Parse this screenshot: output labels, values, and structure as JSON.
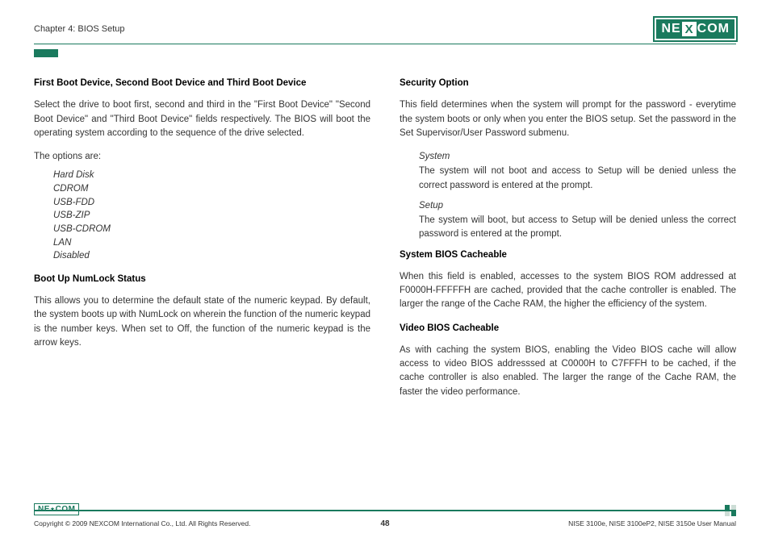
{
  "brand": {
    "ne": "NE",
    "x": "X",
    "com": "COM",
    "small": "NE⋆COM"
  },
  "header": {
    "chapter": "Chapter 4: BIOS Setup"
  },
  "left": {
    "h1": "First Boot Device, Second Boot Device and Third Boot Device",
    "p1": "Select the drive to boot first, second and third in the \"First Boot Device\" \"Second Boot Device\" and \"Third Boot Device\" fields respectively. The BIOS will boot the operating system according to the sequence of the drive selected.",
    "p2": "The options are:",
    "options": [
      "Hard Disk",
      "CDROM",
      "USB-FDD",
      "USB-ZIP",
      "USB-CDROM",
      "LAN",
      "Disabled"
    ],
    "h2": "Boot Up NumLock Status",
    "p3": "This allows you to determine the default state of the numeric keypad. By default, the system boots up with NumLock on wherein the function of the numeric keypad is the number keys. When set to Off, the function of the numeric keypad is the arrow keys."
  },
  "right": {
    "h1": "Security Option",
    "p1": "This field determines when the system will prompt for the password - everytime the system boots or only when you enter the BIOS setup. Set the password in the Set Supervisor/User Password submenu.",
    "sub1_title": "System",
    "sub1_text": "The system will not boot and access to Setup will be denied unless the correct password is entered at the prompt.",
    "sub2_title": "Setup",
    "sub2_text": "The system will boot, but access to Setup will be denied unless the correct password is entered at the prompt.",
    "h2": "System BIOS Cacheable",
    "p2": "When this field is enabled, accesses to the system BIOS ROM addressed at F0000H-FFFFFH are cached, provided that the cache controller is enabled. The larger the range of the Cache RAM, the higher the efficiency of the system.",
    "h3": "Video BIOS Cacheable",
    "p3": "As with caching the system BIOS, enabling the Video BIOS cache will allow access to video BIOS addresssed at C0000H to C7FFFH to be cached, if the cache controller is also enabled. The larger the range of the Cache RAM, the faster the video performance."
  },
  "footer": {
    "copyright": "Copyright © 2009 NEXCOM International Co., Ltd. All Rights Reserved.",
    "page": "48",
    "manual": "NISE 3100e, NISE 3100eP2, NISE 3150e User Manual"
  }
}
